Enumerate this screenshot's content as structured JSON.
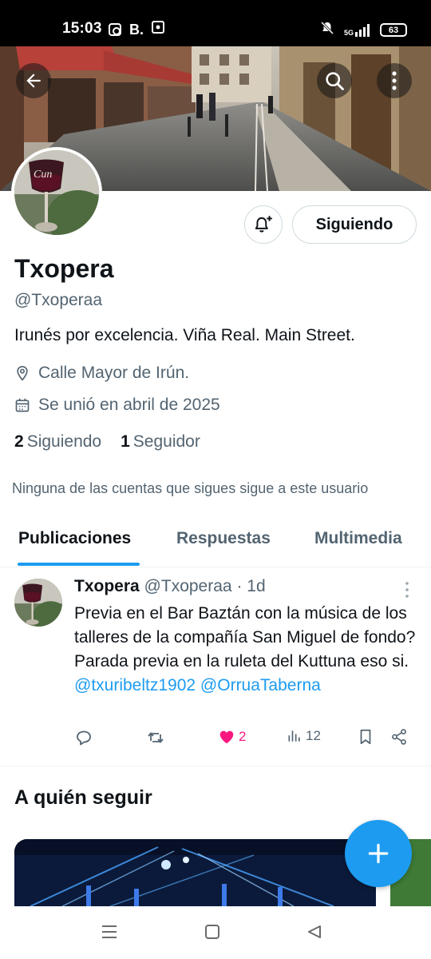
{
  "status_bar": {
    "time": "15:03",
    "brand_letter": "B.",
    "network": "5G",
    "battery": "63",
    "icons": [
      "instagram-icon",
      "b-icon",
      "square-app-icon",
      "mute-icon",
      "signal-icon",
      "battery-icon"
    ]
  },
  "profile": {
    "display_name": "Txopera",
    "handle": "@Txoperaa",
    "bio": "Irunés por excelencia. Viña Real. Main Street.",
    "location": "Calle Mayor de Irún.",
    "joined": "Se unió en abril de 2025",
    "following_count": "2",
    "following_label": "Siguiendo",
    "followers_count": "1",
    "followers_label": "Seguidor",
    "mutuals_note": "Ninguna de las cuentas que sigues sigue a este usuario",
    "follow_button_label": "Siguiendo"
  },
  "tabs": [
    {
      "label": "Publicaciones",
      "active": true
    },
    {
      "label": "Respuestas",
      "active": false
    },
    {
      "label": "Multimedia",
      "active": false
    }
  ],
  "post": {
    "author_name": "Txopera",
    "author_handle": "@Txoperaa",
    "time_ago": "· 1d",
    "text": "Previa en el Bar Baztán con la música de los talleres de la compañía San Miguel de fondo? Parada previa en la ruleta del Kuttuna eso si.",
    "mentions": [
      "@txuribeltz1902",
      "@OrruaTaberna"
    ],
    "likes": "2",
    "views": "12",
    "liked": true
  },
  "who_to_follow": {
    "title": "A quién seguir"
  },
  "colors": {
    "accent": "#1d9bf0",
    "like": "#f91880",
    "secondary_text": "#536471",
    "primary_text": "#0f1419",
    "border": "#cfd9de"
  }
}
